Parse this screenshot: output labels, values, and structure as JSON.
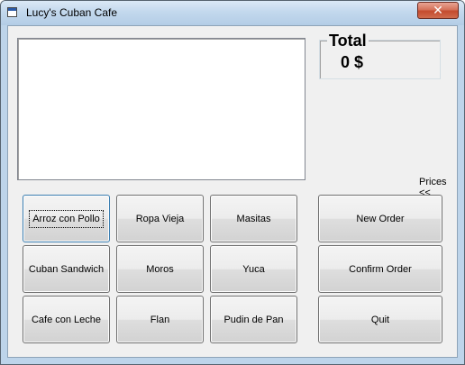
{
  "window": {
    "title": "Lucy's Cuban Cafe",
    "close_glyph": "✕"
  },
  "total": {
    "label": "Total",
    "value": "0 $"
  },
  "prices_toggle": "Prices <<",
  "menu_buttons": {
    "row1": [
      "Arroz con Pollo",
      "Ropa Vieja",
      "Masitas"
    ],
    "row2": [
      "Cuban Sandwich",
      "Moros",
      "Yuca"
    ],
    "row3": [
      "Cafe con Leche",
      "Flan",
      "Pudin de Pan"
    ]
  },
  "actions": {
    "new_order": "New Order",
    "confirm_order": "Confirm Order",
    "quit": "Quit"
  },
  "order_items": [],
  "icons": {
    "app": "window-app-icon",
    "close": "close-icon"
  },
  "colors": {
    "close_button": "#c44b2e",
    "client_background": "#f0f0f0"
  }
}
